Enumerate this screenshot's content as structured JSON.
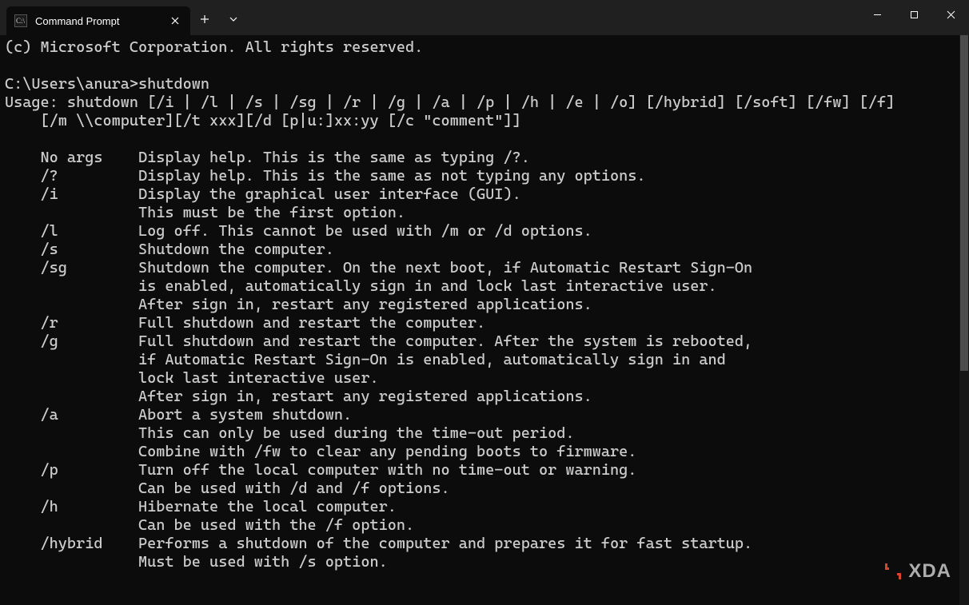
{
  "tab": {
    "title": "Command Prompt"
  },
  "terminal_lines": [
    "(c) Microsoft Corporation. All rights reserved.",
    "",
    "C:\\Users\\anura>shutdown",
    "Usage: shutdown [/i | /l | /s | /sg | /r | /g | /a | /p | /h | /e | /o] [/hybrid] [/soft] [/fw] [/f]",
    "    [/m \\\\computer][/t xxx][/d [p|u:]xx:yy [/c \"comment\"]]",
    "",
    "    No args    Display help. This is the same as typing /?.",
    "    /?         Display help. This is the same as not typing any options.",
    "    /i         Display the graphical user interface (GUI).",
    "               This must be the first option.",
    "    /l         Log off. This cannot be used with /m or /d options.",
    "    /s         Shutdown the computer.",
    "    /sg        Shutdown the computer. On the next boot, if Automatic Restart Sign-On",
    "               is enabled, automatically sign in and lock last interactive user.",
    "               After sign in, restart any registered applications.",
    "    /r         Full shutdown and restart the computer.",
    "    /g         Full shutdown and restart the computer. After the system is rebooted,",
    "               if Automatic Restart Sign-On is enabled, automatically sign in and",
    "               lock last interactive user.",
    "               After sign in, restart any registered applications.",
    "    /a         Abort a system shutdown.",
    "               This can only be used during the time-out period.",
    "               Combine with /fw to clear any pending boots to firmware.",
    "    /p         Turn off the local computer with no time-out or warning.",
    "               Can be used with /d and /f options.",
    "    /h         Hibernate the local computer.",
    "               Can be used with the /f option.",
    "    /hybrid    Performs a shutdown of the computer and prepares it for fast startup.",
    "               Must be used with /s option."
  ],
  "watermark": {
    "text": "XDA"
  }
}
